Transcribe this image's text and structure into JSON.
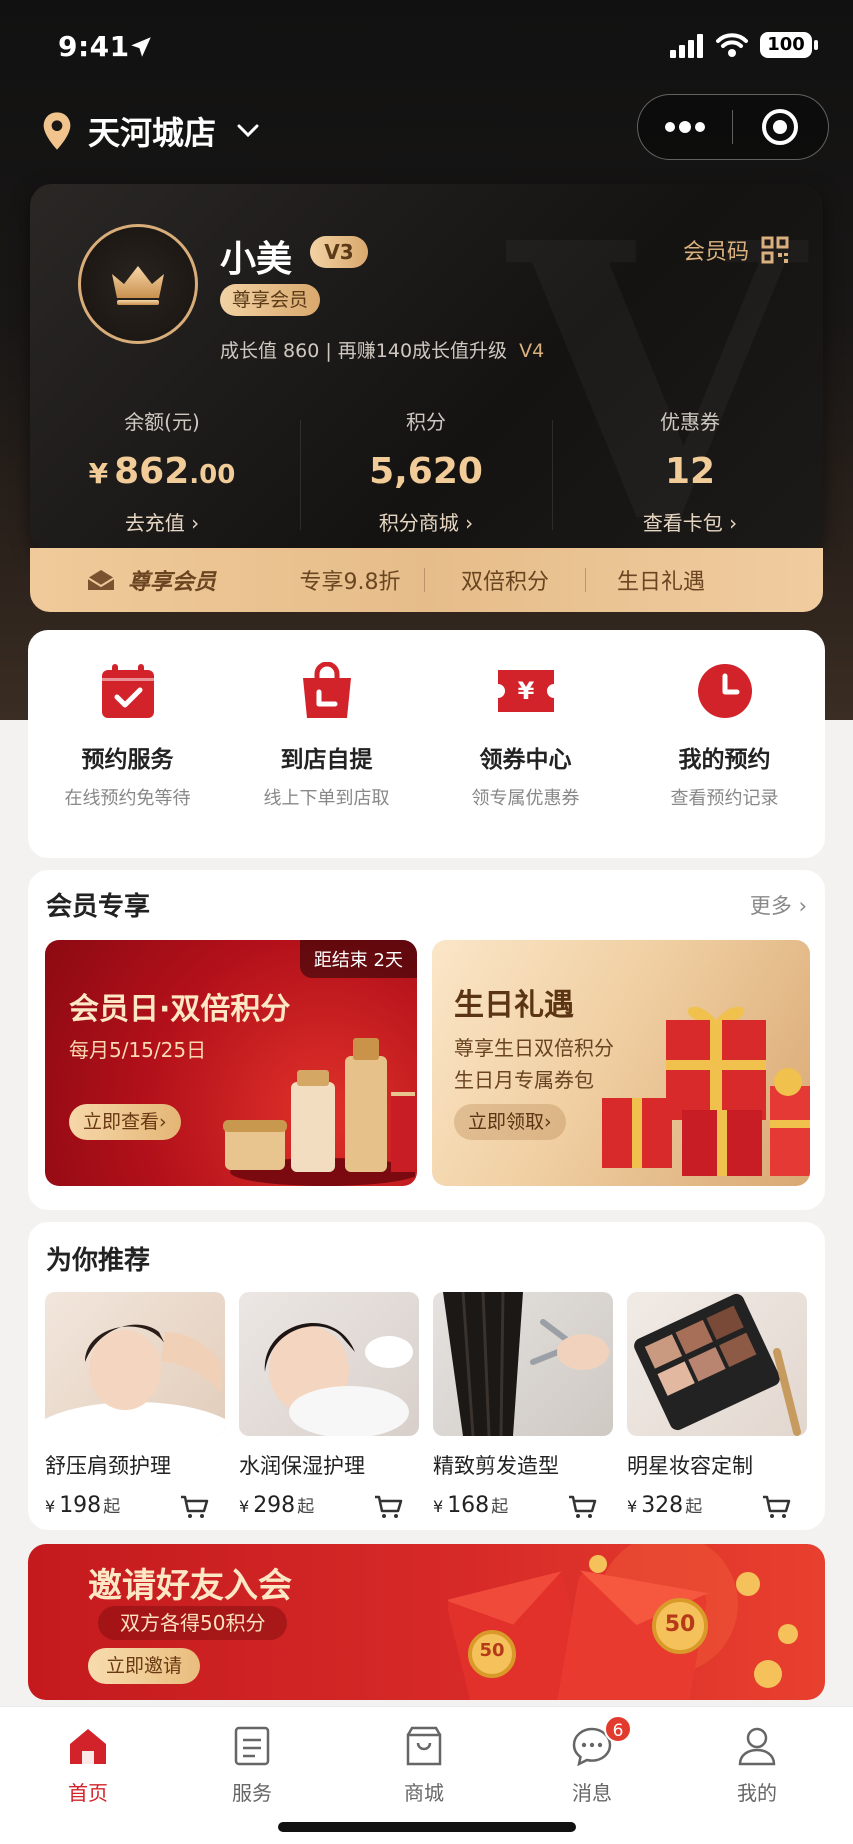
{
  "status": {
    "time": "9:41",
    "battery": "100"
  },
  "header": {
    "store_name": "天河城店"
  },
  "member": {
    "name": "小美",
    "level": "V3",
    "tier": "尊享会员",
    "growth_text": "成长值 860 | 再赚140成长值升级",
    "next_level": "V4",
    "code_label": "会员码",
    "stats": [
      {
        "label": "余额(元)",
        "currency": "¥",
        "value_int": "862",
        "value_dec": ".00",
        "link": "去充值 ›"
      },
      {
        "label": "积分",
        "value": "5,620",
        "link": "积分商城 ›"
      },
      {
        "label": "优惠券",
        "value": "12",
        "link": "查看卡包 ›"
      }
    ]
  },
  "privileges": {
    "title": "尊享会员",
    "items": [
      "专享9.8折",
      "双倍积分",
      "生日礼遇"
    ]
  },
  "services": [
    {
      "title": "预约服务",
      "subtitle": "在线预约免等待",
      "icon": "calendar-check-icon"
    },
    {
      "title": "到店自提",
      "subtitle": "线上下单到店取",
      "icon": "shopping-bag-icon"
    },
    {
      "title": "领券中心",
      "subtitle": "领专属优惠券",
      "icon": "yen-coupon-icon"
    },
    {
      "title": "我的预约",
      "subtitle": "查看预约记录",
      "icon": "clock-icon"
    }
  ],
  "member_exclusive": {
    "title": "会员专享",
    "more": "更多 ›",
    "promos": [
      {
        "countdown": "距结束 2天",
        "title": "会员日·双倍积分",
        "subtitle": "每月5/15/25日",
        "button": "立即查看›"
      },
      {
        "title": "生日礼遇",
        "line1": "尊享生日双倍积分",
        "line2": "生日月专属券包",
        "button": "立即领取›"
      }
    ]
  },
  "recommend": {
    "title": "为你推荐",
    "items": [
      {
        "name": "舒压肩颈护理",
        "currency": "¥",
        "price": "198",
        "suffix": "起"
      },
      {
        "name": "水润保湿护理",
        "currency": "¥",
        "price": "298",
        "suffix": "起"
      },
      {
        "name": "精致剪发造型",
        "currency": "¥",
        "price": "168",
        "suffix": "起"
      },
      {
        "name": "明星妆容定制",
        "currency": "¥",
        "price": "328",
        "suffix": "起"
      }
    ]
  },
  "invite": {
    "title": "邀请好友入会",
    "subtitle": "双方各得50积分",
    "button": "立即邀请",
    "coin": "50"
  },
  "tabs": [
    {
      "label": "首页",
      "icon": "home-icon",
      "active": true
    },
    {
      "label": "服务",
      "icon": "document-icon"
    },
    {
      "label": "商城",
      "icon": "store-icon"
    },
    {
      "label": "消息",
      "icon": "chat-icon",
      "badge": "6"
    },
    {
      "label": "我的",
      "icon": "user-icon"
    }
  ],
  "colors": {
    "brand_red": "#d3232a",
    "gold": "#e1b67f",
    "dark": "#141312"
  }
}
